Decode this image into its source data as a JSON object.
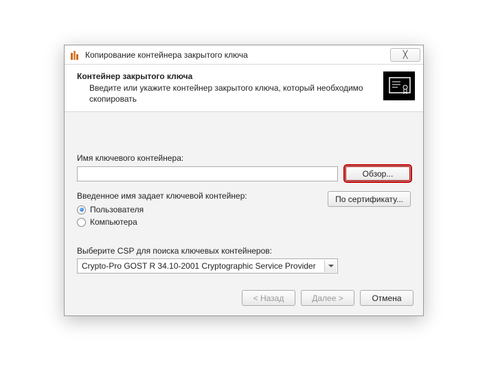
{
  "window": {
    "title": "Копирование контейнера закрытого ключа",
    "close_symbol": "╳"
  },
  "header": {
    "title": "Контейнер закрытого ключа",
    "subtitle": "Введите или укажите контейнер закрытого ключа, который необходимо скопировать"
  },
  "body": {
    "container_name_label": "Имя ключевого контейнера:",
    "container_name_value": "",
    "browse_label": "Обзор...",
    "by_cert_label": "По сертификату...",
    "scope_label": "Введенное имя задает ключевой контейнер:",
    "scope_options": {
      "user": "Пользователя",
      "computer": "Компьютера"
    },
    "scope_selected": "user",
    "csp_label": "Выберите CSP для поиска ключевых контейнеров:",
    "csp_selected": "Crypto-Pro GOST R 34.10-2001 Cryptographic Service Provider"
  },
  "footer": {
    "back_label": "< Назад",
    "next_label": "Далее >",
    "cancel_label": "Отмена"
  }
}
